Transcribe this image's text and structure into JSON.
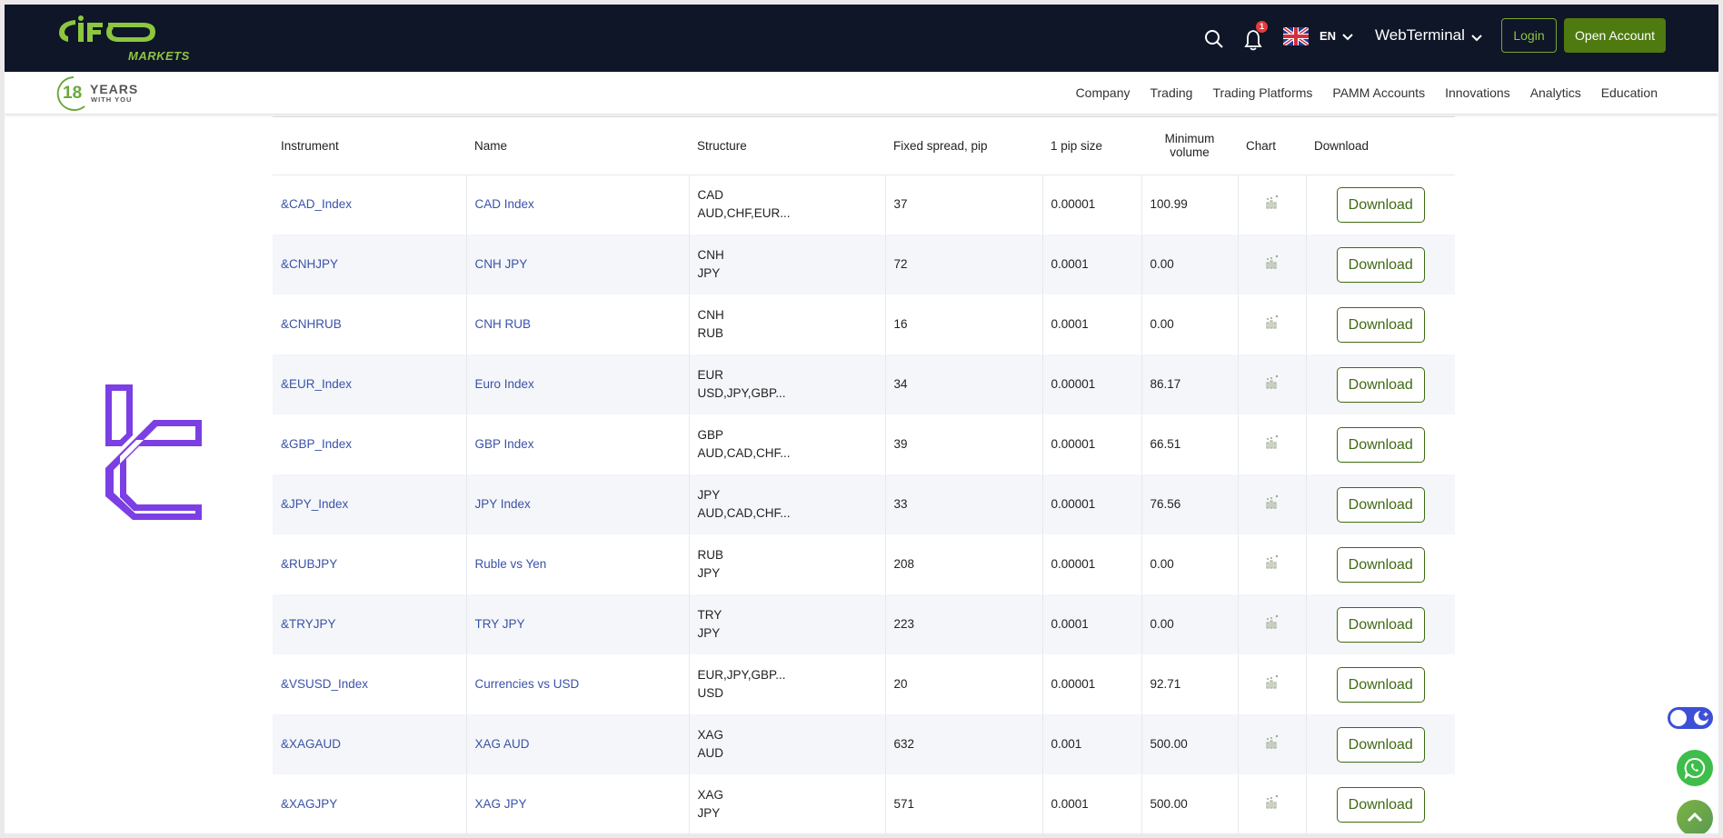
{
  "header": {
    "brand_name": "IFC",
    "brand_sub": "MARKETS",
    "notification_count": "1",
    "language": "EN",
    "web_terminal_label": "WebTerminal",
    "login_label": "Login",
    "open_account_label": "Open Account",
    "icons": {
      "search": "search-icon",
      "bell": "bell-icon",
      "flag": "uk-flag-icon",
      "chevron": "chevron-down-icon"
    }
  },
  "navbar": {
    "years_number": "18",
    "years_word": "YEARS",
    "years_sub": "WITH YOU",
    "links": [
      "Company",
      "Trading",
      "Trading Platforms",
      "PAMM Accounts",
      "Innovations",
      "Analytics",
      "Education"
    ]
  },
  "table": {
    "columns": [
      "Instrument",
      "Name",
      "Structure",
      "Fixed spread, pip",
      "1 pip size",
      "Minimum volume",
      "Chart",
      "Download"
    ],
    "columns_min_volume_lines": [
      "Minimum",
      "volume"
    ],
    "download_label": "Download",
    "rows": [
      {
        "instrument": "&CAD_Index",
        "name": "CAD Index",
        "structure": [
          "CAD",
          "AUD,CHF,EUR..."
        ],
        "spread": "37",
        "pip_size": "0.00001",
        "min_volume": "100.99"
      },
      {
        "instrument": "&CNHJPY",
        "name": "CNH JPY",
        "structure": [
          "CNH",
          "JPY"
        ],
        "spread": "72",
        "pip_size": "0.0001",
        "min_volume": "0.00"
      },
      {
        "instrument": "&CNHRUB",
        "name": "CNH RUB",
        "structure": [
          "CNH",
          "RUB"
        ],
        "spread": "16",
        "pip_size": "0.0001",
        "min_volume": "0.00"
      },
      {
        "instrument": "&EUR_Index",
        "name": "Euro Index",
        "structure": [
          "EUR",
          "USD,JPY,GBP..."
        ],
        "spread": "34",
        "pip_size": "0.00001",
        "min_volume": "86.17"
      },
      {
        "instrument": "&GBP_Index",
        "name": "GBP Index",
        "structure": [
          "GBP",
          "AUD,CAD,CHF..."
        ],
        "spread": "39",
        "pip_size": "0.00001",
        "min_volume": "66.51"
      },
      {
        "instrument": "&JPY_Index",
        "name": "JPY Index",
        "structure": [
          "JPY",
          "AUD,CAD,CHF..."
        ],
        "spread": "33",
        "pip_size": "0.00001",
        "min_volume": "76.56"
      },
      {
        "instrument": "&RUBJPY",
        "name": "Ruble vs Yen",
        "structure": [
          "RUB",
          "JPY"
        ],
        "spread": "208",
        "pip_size": "0.00001",
        "min_volume": "0.00"
      },
      {
        "instrument": "&TRYJPY",
        "name": "TRY JPY",
        "structure": [
          "TRY",
          "JPY"
        ],
        "spread": "223",
        "pip_size": "0.0001",
        "min_volume": "0.00"
      },
      {
        "instrument": "&VSUSD_Index",
        "name": "Currencies vs USD",
        "structure": [
          "EUR,JPY,GBP...",
          "USD"
        ],
        "spread": "20",
        "pip_size": "0.00001",
        "min_volume": "92.71"
      },
      {
        "instrument": "&XAGAUD",
        "name": "XAG AUD",
        "structure": [
          "XAG",
          "AUD"
        ],
        "spread": "632",
        "pip_size": "0.001",
        "min_volume": "500.00"
      },
      {
        "instrument": "&XAGJPY",
        "name": "XAG JPY",
        "structure": [
          "XAG",
          "JPY"
        ],
        "spread": "571",
        "pip_size": "0.0001",
        "min_volume": "500.00"
      }
    ]
  },
  "widgets": {
    "theme_toggle": "dark-mode-toggle",
    "whatsapp": "whatsapp-icon",
    "scroll_top": "chevron-up-icon"
  },
  "colors": {
    "header_bg": "#0f1628",
    "brand_green": "#8dc63f",
    "open_account_bg": "#4e7a10",
    "link_blue": "#3a52a8",
    "download_green": "#3d6a12",
    "side_logo_purple": "#7b3fe4",
    "row_alt_bg": "#f4f6f9"
  }
}
